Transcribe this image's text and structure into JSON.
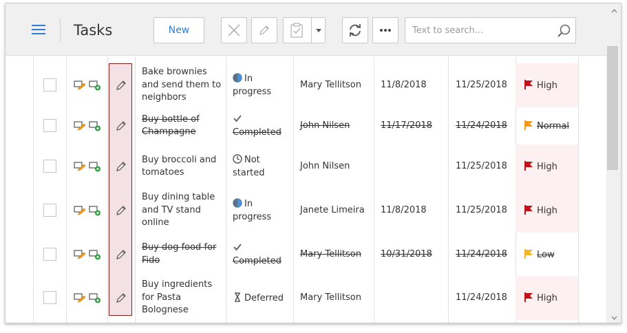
{
  "toolbar": {
    "title": "Tasks",
    "new_label": "New",
    "search_placeholder": "Text to search...",
    "search_value": ""
  },
  "colors": {
    "accent": "#2f7fd2",
    "high": "#c0101a",
    "normal": "#f29a1a",
    "low": "#f6b428",
    "high_row_bg": "#fdf0f0"
  },
  "tasks": [
    {
      "subject_lines": [
        "Bake brownies",
        "and send them to",
        "neighbors"
      ],
      "status_lines": [
        "In",
        "progress"
      ],
      "status_icon": "half-circle-icon",
      "assigned": "Mary Tellitson",
      "start": "11/8/2018",
      "due": "11/25/2018",
      "priority": "High",
      "completed": false
    },
    {
      "subject_lines": [
        "Buy bottle of",
        "Champagne"
      ],
      "status_lines": [
        "",
        "Completed"
      ],
      "status_icon": "check-icon",
      "assigned": "John Nilsen",
      "start": "11/17/2018",
      "due": "11/24/2018",
      "priority": "Normal",
      "completed": true
    },
    {
      "subject_lines": [
        "Buy broccoli and",
        "tomatoes"
      ],
      "status_lines": [
        "Not",
        "started"
      ],
      "status_icon": "clock-icon",
      "assigned": "John Nilsen",
      "start": "",
      "due": "11/25/2018",
      "priority": "High",
      "completed": false
    },
    {
      "subject_lines": [
        "Buy dining table",
        "and TV stand",
        "online"
      ],
      "status_lines": [
        "In",
        "progress"
      ],
      "status_icon": "half-circle-icon",
      "assigned": "Janete Limeira",
      "start": "11/8/2018",
      "due": "11/25/2018",
      "priority": "High",
      "completed": false
    },
    {
      "subject_lines": [
        "Buy dog food for",
        "Fido"
      ],
      "status_lines": [
        "",
        "Completed"
      ],
      "status_icon": "check-icon",
      "assigned": "Mary Tellitson",
      "start": "10/31/2018",
      "due": "11/24/2018",
      "priority": "Low",
      "completed": true
    },
    {
      "subject_lines": [
        "Buy ingredients",
        "for Pasta",
        "Bolognese"
      ],
      "status_lines": [
        "Deferred"
      ],
      "status_icon": "hourglass-icon",
      "assigned": "Mary Tellitson",
      "start": "",
      "due": "11/24/2018",
      "priority": "High",
      "completed": false
    }
  ]
}
